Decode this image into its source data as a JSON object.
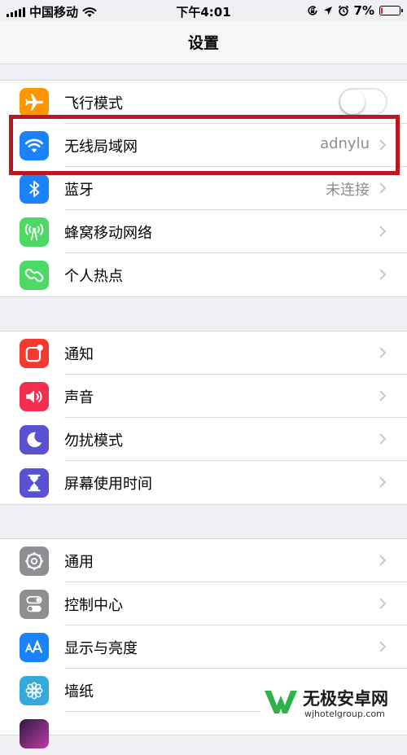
{
  "status_bar": {
    "carrier": "中国移动",
    "time": "下午4:01",
    "battery": "7%",
    "battery_level": 0.07,
    "icons": [
      "signal-icon",
      "wifi-icon",
      "screen-lock-icon",
      "location-icon",
      "alarm-icon",
      "battery-icon"
    ]
  },
  "nav": {
    "title": "设置"
  },
  "groups": [
    {
      "rows": [
        {
          "label": "飞行模式",
          "icon": "airplane-icon",
          "color": "#ff9500",
          "control": "toggle",
          "toggle_on": false
        },
        {
          "label": "无线局域网",
          "icon": "wifi-icon",
          "color": "#1a82fb",
          "value": "adnylu"
        },
        {
          "label": "蓝牙",
          "icon": "bluetooth-icon",
          "color": "#1a82fb",
          "value": "未连接"
        },
        {
          "label": "蜂窝移动网络",
          "icon": "cellular-icon",
          "color": "#4cd964"
        },
        {
          "label": "个人热点",
          "icon": "hotspot-icon",
          "color": "#4cd964"
        }
      ]
    },
    {
      "rows": [
        {
          "label": "通知",
          "icon": "notifications-icon",
          "color": "#f23a30"
        },
        {
          "label": "声音",
          "icon": "sound-icon",
          "color": "#f2304e"
        },
        {
          "label": "勿扰模式",
          "icon": "moon-icon",
          "color": "#5a50d2"
        },
        {
          "label": "屏幕使用时间",
          "icon": "hourglass-icon",
          "color": "#5a50d2"
        }
      ]
    },
    {
      "rows": [
        {
          "label": "通用",
          "icon": "gear-icon",
          "color": "#8e8e93"
        },
        {
          "label": "控制中心",
          "icon": "switches-icon",
          "color": "#8e8e93"
        },
        {
          "label": "显示与亮度",
          "icon": "text-size-icon",
          "color": "#1a82fb"
        },
        {
          "label": "墙纸",
          "icon": "flower-icon",
          "color": "#34aadc"
        }
      ]
    }
  ],
  "watermark": {
    "title": "无极安卓网",
    "url": "wjhotelgroup.com",
    "logo_color": "#2fb24a"
  },
  "annotation": {
    "color": "#b8181e"
  }
}
